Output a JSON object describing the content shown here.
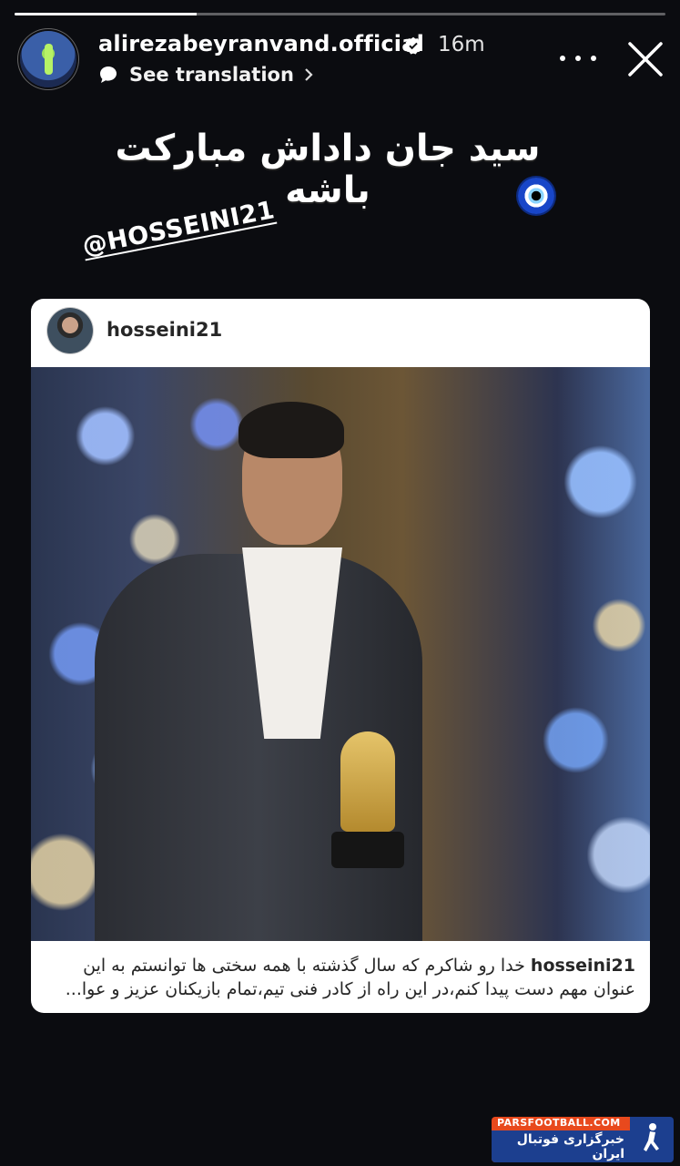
{
  "story": {
    "progress_fraction": 0.28,
    "username": "alirezabeyranvand.official",
    "time": "16m",
    "translate_label": "See translation",
    "title_text": "سید جان داداش مبارکت باشه",
    "mention": "@HOSSEINI21"
  },
  "shared_post": {
    "username": "hosseini21",
    "caption_user": "hosseini21",
    "caption_text": "خدا رو شاکرم که سال گذشته با همه سختی ها توانستم به این عنوان مهم دست پیدا کنم،در این راه از کادر فنی تیم،تمام بازیکنان عزیز و عوا..."
  },
  "watermark": {
    "text_en": "PARSFOOTBALL.COM",
    "text_fa": "خبرگزاری فوتبال ایران"
  },
  "icons": {
    "verified": "verified-badge-icon",
    "translate": "speech-bubble-icon",
    "more": "more-dots-icon",
    "close": "close-icon",
    "evil_eye": "nazar-eye-emoji"
  },
  "colors": {
    "background": "#0b0c10",
    "verified": "#ffffff",
    "watermark_orange": "#e8491d",
    "watermark_blue": "#1c3f8f"
  }
}
